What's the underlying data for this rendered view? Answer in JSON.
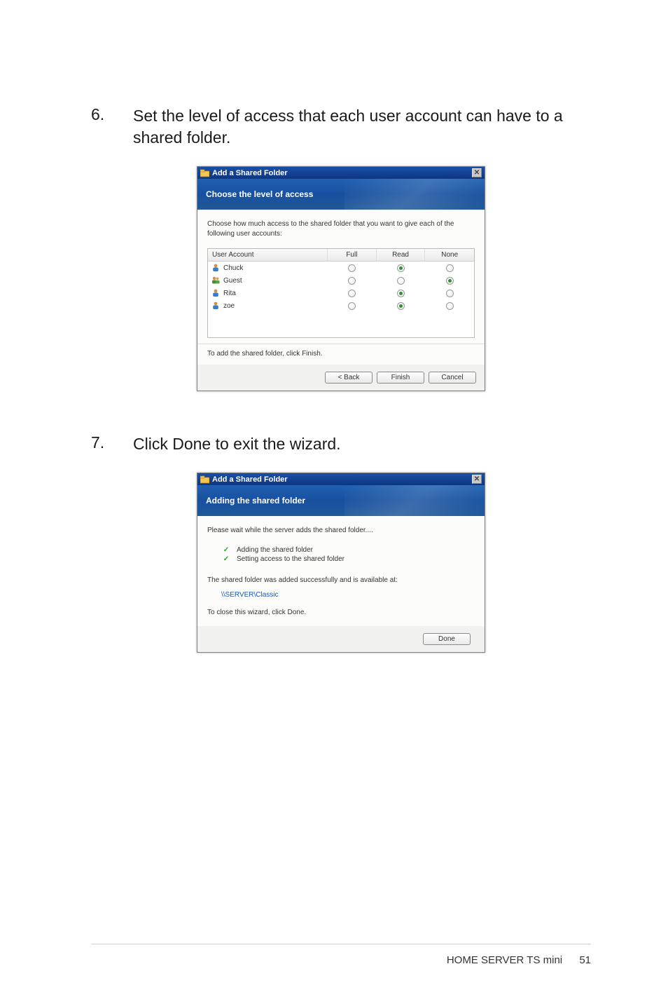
{
  "step6": {
    "num": "6.",
    "text": "Set the level of access that each user account can have to a shared folder."
  },
  "step7": {
    "num": "7.",
    "text": "Click Done to exit the wizard."
  },
  "dialog1": {
    "title": "Add a Shared Folder",
    "banner": "Choose the level of access",
    "instr": "Choose how much access to the shared folder that you want to give each of the following user accounts:",
    "columns": {
      "ua": "User Account",
      "full": "Full",
      "read": "Read",
      "none": "None"
    },
    "rows": [
      {
        "name": "Chuck",
        "icon": "single",
        "selected": "read"
      },
      {
        "name": "Guest",
        "icon": "multi",
        "selected": "none"
      },
      {
        "name": "Rita",
        "icon": "single",
        "selected": "read"
      },
      {
        "name": "zoe",
        "icon": "single",
        "selected": "read"
      }
    ],
    "bottom_text": "To add the shared folder, click Finish.",
    "btn_back": "< Back",
    "btn_finish": "Finish",
    "btn_cancel": "Cancel"
  },
  "dialog2": {
    "title": "Add a Shared Folder",
    "banner": "Adding the shared folder",
    "instr": "Please wait while the server adds the shared folder....",
    "tasks": [
      "Adding the shared folder",
      "Setting access to the shared folder"
    ],
    "success_text": "The shared folder was added successfully and is available at:",
    "path": "\\\\SERVER\\Classic",
    "final": "To close this wizard, click Done.",
    "btn_done": "Done"
  },
  "footer": {
    "label": "HOME SERVER TS mini",
    "page": "51"
  }
}
